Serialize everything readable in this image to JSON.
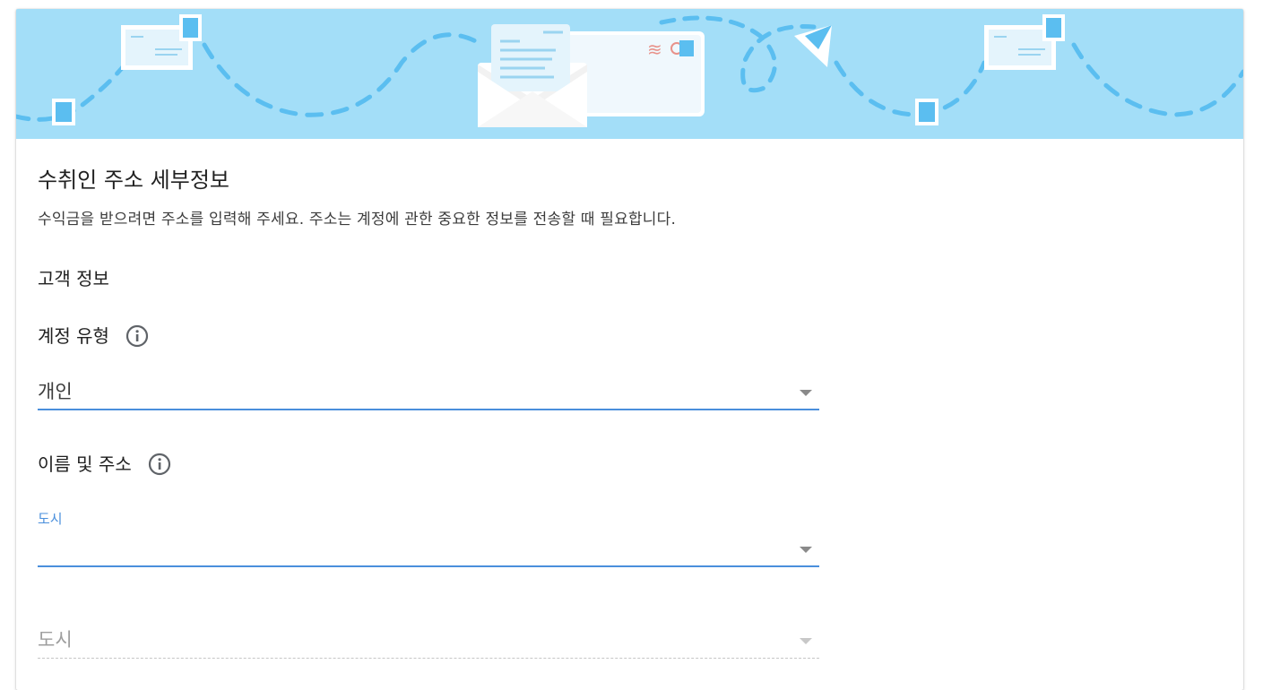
{
  "form": {
    "title": "수취인 주소 세부정보",
    "description": "수익금을 받으려면 주소를 입력해 주세요. 주소는 계정에 관한 중요한 정보를 전송할 때 필요합니다.",
    "section_customer": "고객 정보",
    "account_type": {
      "label": "계정 유형",
      "value": "개인",
      "icon": "info-icon"
    },
    "name_address": {
      "label": "이름 및 주소",
      "icon": "info-icon"
    },
    "city_select": {
      "floating_label": "도시",
      "value": ""
    },
    "city_select_disabled": {
      "placeholder": "도시"
    }
  },
  "colors": {
    "banner": "#a3def8",
    "accent": "#4a8fdc"
  }
}
